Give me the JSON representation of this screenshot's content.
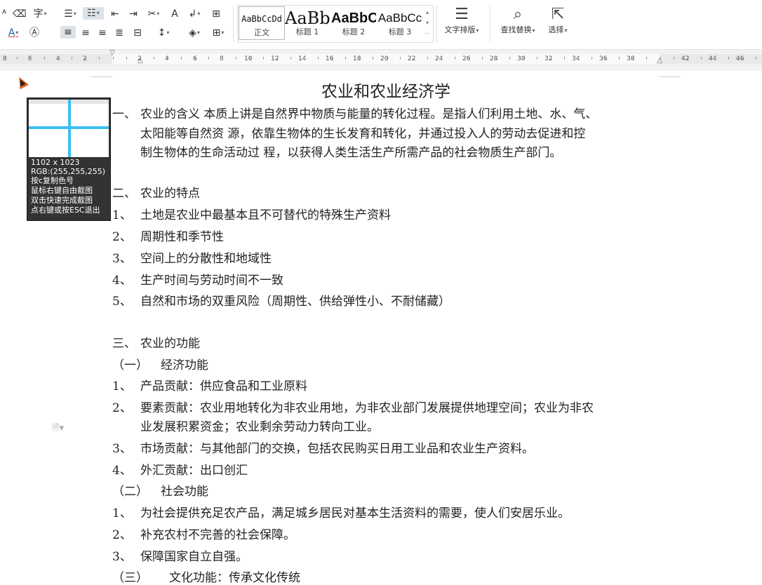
{
  "toolbar": {
    "styles": [
      {
        "preview": "AaBbCcDd",
        "label": "正文",
        "selected": true
      },
      {
        "preview": "AaBb",
        "label": "标题 1",
        "selected": false
      },
      {
        "preview": "AaBbC",
        "label": "标题 2",
        "selected": false
      },
      {
        "preview": "AaBbCc",
        "label": "标题 3",
        "selected": false
      }
    ],
    "text_layout_label": "文字排版",
    "find_replace_label": "查找替换",
    "select_label": "选择"
  },
  "ruler": {
    "labels": [
      "8",
      "6",
      "4",
      "2",
      "2",
      "4",
      "6",
      "8",
      "10",
      "12",
      "14",
      "16",
      "18",
      "20",
      "22",
      "24",
      "26",
      "28",
      "30",
      "32",
      "34",
      "36",
      "38",
      "42",
      "44",
      "46"
    ]
  },
  "magnifier": {
    "size": "1102 x 1023",
    "rgb": "RGB:(255,255,255)",
    "hint1": "按c复制色号",
    "hint2": "鼠标右键自由截图",
    "hint3": "双击快速完成截图",
    "hint4": "点右键或按ESC退出"
  },
  "document": {
    "title": "农业和农业经济学",
    "lines": [
      {
        "marker": "一、",
        "text": "农业的含义 本质上讲是自然界中物质与能量的转化过程。是指人们利用土地、水、气、"
      },
      {
        "marker": "",
        "text": "太阳能等自然资 源，依靠生物体的生长发育和转化，并通过投入人的劳动去促进和控"
      },
      {
        "marker": "",
        "text": "制生物体的生命活动过 程，以获得人类生活生产所需产品的社会物质生产部门。"
      },
      {
        "marker": "二、",
        "text": "农业的特点"
      },
      {
        "marker": "1、",
        "text": "土地是农业中最基本且不可替代的特殊生产资料"
      },
      {
        "marker": "2、",
        "text": "周期性和季节性"
      },
      {
        "marker": "3、",
        "text": "空间上的分散性和地域性"
      },
      {
        "marker": "4、",
        "text": "生产时间与劳动时间不一致"
      },
      {
        "marker": "5、",
        "text": "自然和市场的双重风险（周期性、供给弹性小、不耐储藏）"
      },
      {
        "marker": "三、",
        "text": "农业的功能"
      },
      {
        "marker": "（一）",
        "text": "经济功能"
      },
      {
        "marker": "1、",
        "text": "产品贡献：供应食品和工业原料"
      },
      {
        "marker": "2、",
        "text": "要素贡献：农业用地转化为非农业用地，为非农业部门发展提供地理空间；农业为非农"
      },
      {
        "marker": "",
        "text": "业发展积累资金；农业剩余劳动力转向工业。"
      },
      {
        "marker": "3、",
        "text": "市场贡献：与其他部门的交换，包括农民购买日用工业品和农业生产资料。"
      },
      {
        "marker": "4、",
        "text": "外汇贡献：出口创汇"
      },
      {
        "marker": "（二）",
        "text": "社会功能"
      },
      {
        "marker": "1、",
        "text": "为社会提供充足农产品，满足城乡居民对基本生活资料的需要，使人们安居乐业。"
      },
      {
        "marker": "2、",
        "text": "补充农村不完善的社会保障。"
      },
      {
        "marker": "3、",
        "text": "保障国家自立自强。"
      },
      {
        "marker": "（三）",
        "text": "文化功能：传承文化传统"
      }
    ]
  }
}
